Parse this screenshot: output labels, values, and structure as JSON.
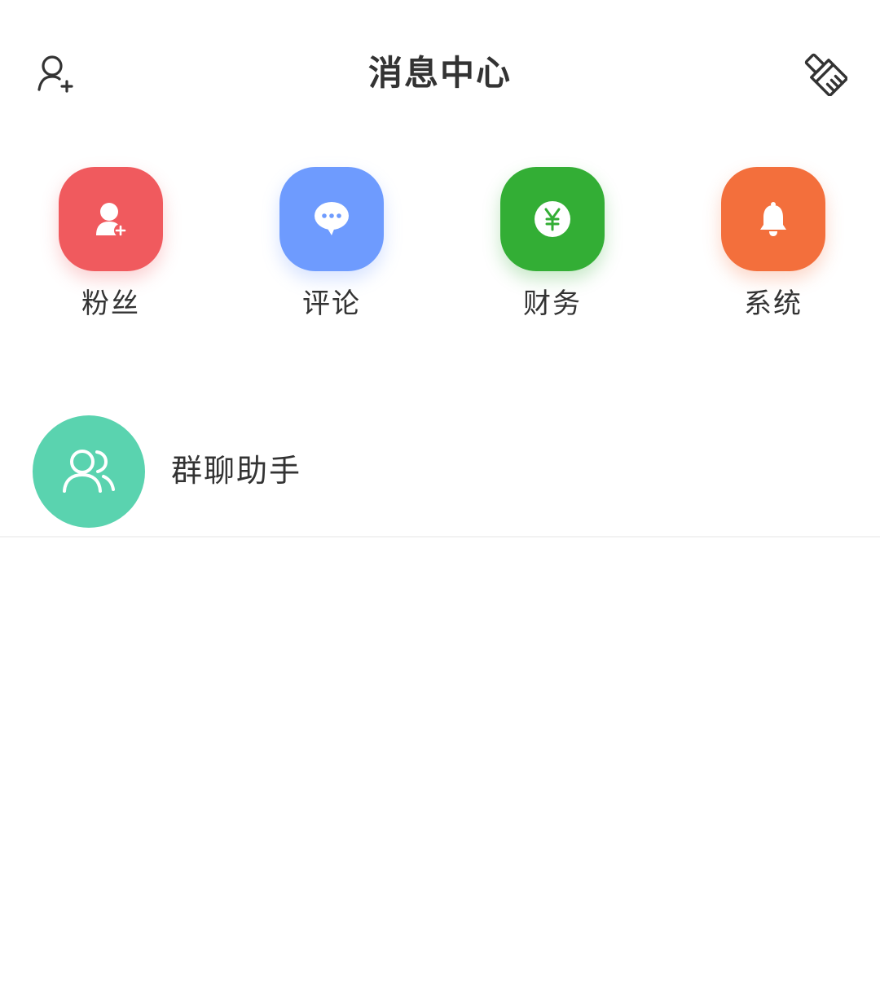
{
  "header": {
    "title": "消息中心",
    "left_icon": "add-user-icon",
    "right_icon": "clear-brush-icon"
  },
  "categories": [
    {
      "label": "粉丝",
      "icon": "fans-add-user-icon",
      "color": "#F05A5E"
    },
    {
      "label": "评论",
      "icon": "comment-bubble-icon",
      "color": "#6E9BFE"
    },
    {
      "label": "财务",
      "icon": "yuan-coin-icon",
      "color": "#33AE35"
    },
    {
      "label": "系统",
      "icon": "bell-icon",
      "color": "#F36F3C"
    }
  ],
  "list": [
    {
      "title": "群聊助手",
      "icon": "group-users-icon",
      "color": "#5AD3AF"
    }
  ]
}
